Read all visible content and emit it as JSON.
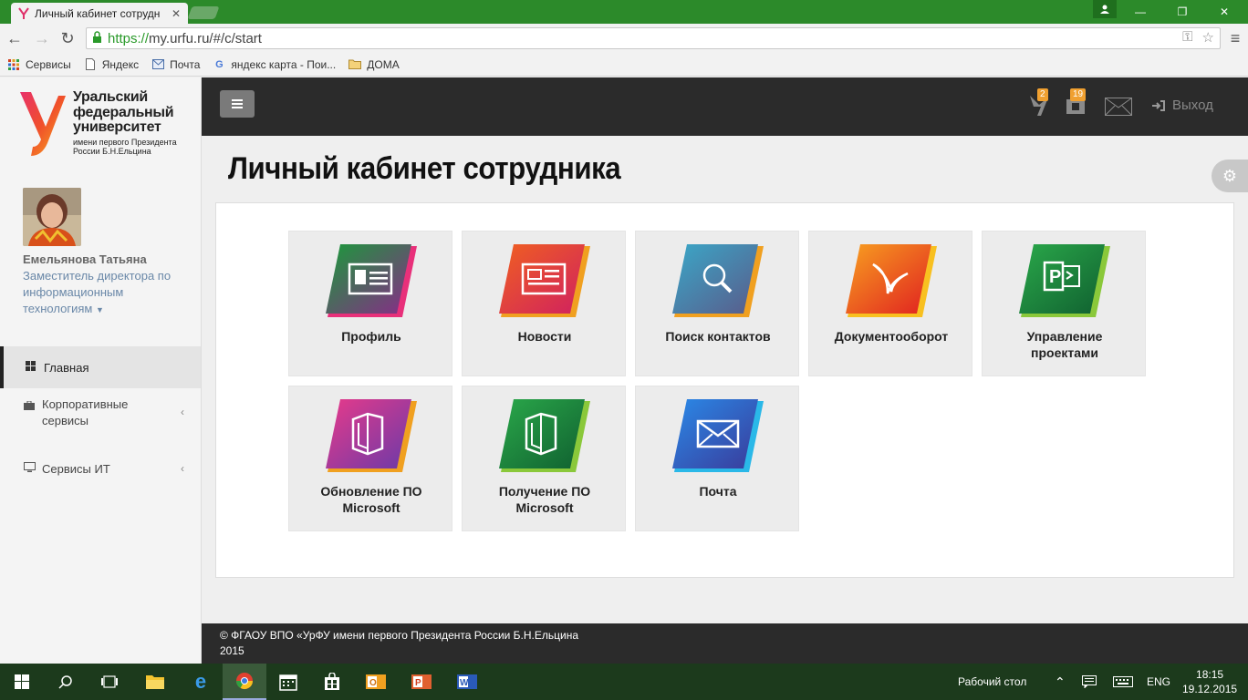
{
  "browser": {
    "tab_title": "Личный кабинет сотрудн",
    "url_scheme": "https://",
    "url_rest": "my.urfu.ru/#/c/start",
    "bookmarks": [
      {
        "label": "Сервисы",
        "icon": "apps-grid-icon"
      },
      {
        "label": "Яндекс",
        "icon": "page-icon"
      },
      {
        "label": "Почта",
        "icon": "mail-icon"
      },
      {
        "label": "яндекс карта - Пои...",
        "icon": "google-icon"
      },
      {
        "label": "ДОМА",
        "icon": "folder-icon"
      }
    ]
  },
  "sidebar": {
    "logo": {
      "line1": "Уральский",
      "line2": "федеральный",
      "line3": "университет",
      "sub1": "имени первого Президента",
      "sub2": "России Б.Н.Ельцина"
    },
    "user_name": "Емельянова Татьяна",
    "user_position": "Заместитель директора по информационным технологиям",
    "nav": [
      {
        "label": "Главная"
      },
      {
        "label": "Корпоративные сервисы"
      },
      {
        "label": "Сервисы ИТ"
      }
    ]
  },
  "header": {
    "badge_docs": "2",
    "badge_tasks": "19",
    "logout_label": "Выход"
  },
  "page_title": "Личный кабинет сотрудника",
  "tiles": [
    {
      "label": "Профиль"
    },
    {
      "label": "Новости"
    },
    {
      "label": "Поиск контактов"
    },
    {
      "label": "Документооборот"
    },
    {
      "label": "Управление проектами"
    },
    {
      "label": "Обновление ПО Microsoft"
    },
    {
      "label": "Получение ПО Microsoft"
    },
    {
      "label": "Почта"
    }
  ],
  "footer": {
    "line1": "© ФГАОУ ВПО «УрФУ имени первого Президента России Б.Н.Ельцина",
    "line2": "2015"
  },
  "taskbar": {
    "desktop_label": "Рабочий стол",
    "lang": "ENG",
    "time": "18:15",
    "date": "19.12.2015"
  },
  "colors": {
    "header_bg": "#2b2b2b",
    "accent_green": "#2c8a2a",
    "badge": "#f0a030"
  }
}
